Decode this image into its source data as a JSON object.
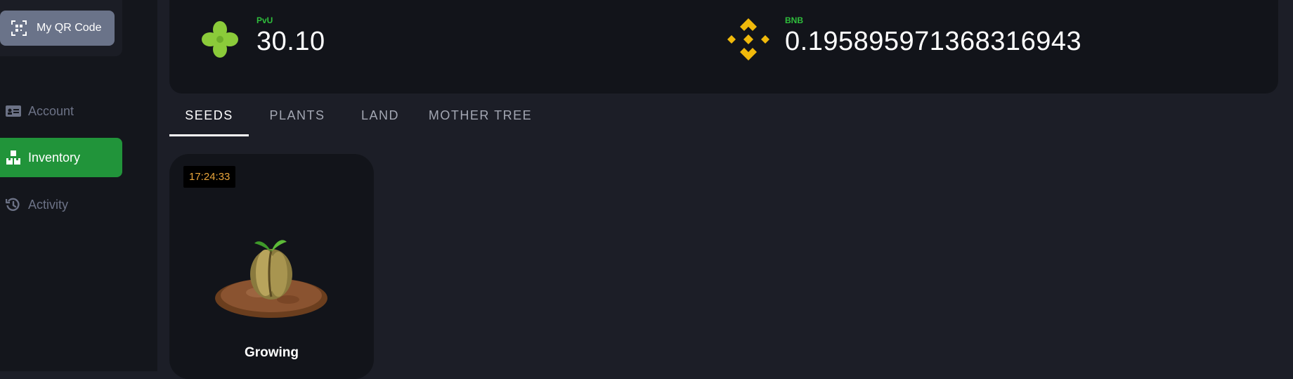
{
  "sidebar": {
    "qr_button_label": "My QR Code",
    "items": [
      {
        "label": "Account",
        "icon": "id-card-icon"
      },
      {
        "label": "Inventory",
        "icon": "boxes-icon",
        "active": true
      },
      {
        "label": "Activity",
        "icon": "history-icon"
      }
    ]
  },
  "balances": {
    "pvu": {
      "name": "PvU",
      "amount": "30.10",
      "icon": "clover-icon"
    },
    "bnb": {
      "name": "BNB",
      "amount": "0.195895971368316943",
      "icon": "binance-icon"
    }
  },
  "tabs": [
    {
      "label": "SEEDS",
      "active": true
    },
    {
      "label": "PLANTS"
    },
    {
      "label": "LAND"
    },
    {
      "label": "MOTHER TREE"
    }
  ],
  "seeds": [
    {
      "timer": "17:24:33",
      "status": "Growing",
      "image": "sprouting-seed-image"
    }
  ],
  "colors": {
    "accent_green": "#21943a",
    "label_green": "#2fbe3c",
    "binance_yellow": "#f0b90b",
    "timer_orange": "#e8a43a",
    "qr_button": "#6a7389"
  }
}
